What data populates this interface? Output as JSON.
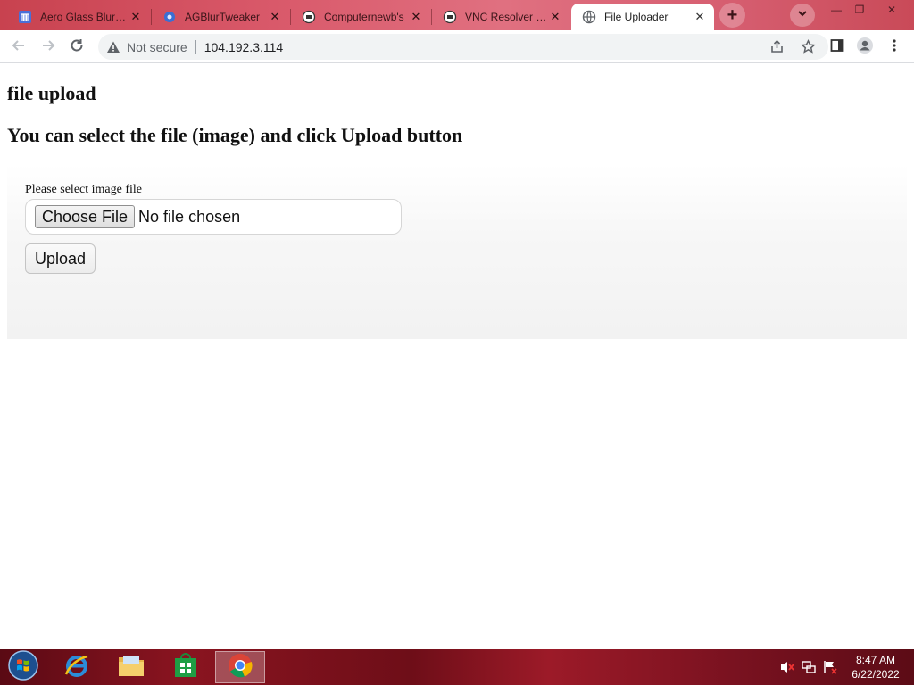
{
  "browser": {
    "tabs": [
      {
        "title": "Aero Glass Blur Tweaker",
        "favicon": "aero-glass-icon"
      },
      {
        "title": "AGBlurTweaker",
        "favicon": "agblur-icon"
      },
      {
        "title": "Computernewb's",
        "favicon": "computernewb-icon"
      },
      {
        "title": "VNC Resolver - B",
        "favicon": "vnc-resolver-icon"
      },
      {
        "title": "File Uploader",
        "favicon": "globe-icon",
        "active": true
      }
    ],
    "new_tab_label": "+",
    "address": {
      "security_label": "Not secure",
      "url": "104.192.3.114"
    }
  },
  "page": {
    "heading": "file upload",
    "subheading": "You can select the file (image) and click Upload button",
    "form": {
      "label": "Please select image file",
      "choose_button": "Choose File",
      "no_file_text": "No file chosen",
      "upload_button": "Upload"
    }
  },
  "taskbar": {
    "apps": [
      "internet-explorer-icon",
      "file-explorer-icon",
      "store-icon",
      "chrome-icon"
    ],
    "clock": {
      "time": "8:47 AM",
      "date": "6/22/2022"
    }
  },
  "colors": {
    "tabstrip": "#d9596a",
    "taskbar": "#8a1420",
    "page_bg": "#ffffff",
    "form_panel": "#f2f2f2"
  }
}
